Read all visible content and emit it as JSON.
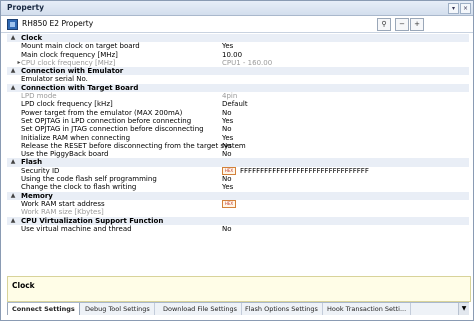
{
  "window": {
    "title": "Property"
  },
  "toolbar": {
    "device_name": "RH850 E2 Property"
  },
  "grid": {
    "categories": [
      {
        "label": "Clock",
        "rows": [
          {
            "name": "Mount main clock on target board",
            "value": "Yes"
          },
          {
            "name": "Main clock frequency [MHz]",
            "value": "10.00"
          },
          {
            "name": "CPU clock frequency [MHz]",
            "value": "CPU1 - 160.00"
          }
        ]
      },
      {
        "label": "Connection with Emulator",
        "rows": [
          {
            "name": "Emulator serial No.",
            "value": ""
          }
        ]
      },
      {
        "label": "Connection with Target Board",
        "rows": [
          {
            "name": "LPD mode",
            "value": "4pin"
          },
          {
            "name": "LPD clock frequency [kHz]",
            "value": "Default"
          },
          {
            "name": "Power target from the emulator (MAX 200mA)",
            "value": "No"
          },
          {
            "name": "Set OPJTAG in LPD connection before connecting",
            "value": "Yes"
          },
          {
            "name": "Set OPJTAG in JTAG connection before disconnecting",
            "value": "No"
          },
          {
            "name": "Initialize RAM when connecting",
            "value": "Yes"
          },
          {
            "name": "Release the RESET before disconnecting from the target system",
            "value": "No"
          },
          {
            "name": "Use the PiggyBack board",
            "value": "No"
          }
        ]
      },
      {
        "label": "Flash",
        "rows": [
          {
            "name": "Security ID",
            "value": "FFFFFFFFFFFFFFFFFFFFFFFFFFFFFFFF",
            "badge": "HEX"
          },
          {
            "name": "Using the code flash self programming",
            "value": "No"
          },
          {
            "name": "Change the clock to flash writing",
            "value": "Yes"
          }
        ]
      },
      {
        "label": "Memory",
        "rows": [
          {
            "name": "Work RAM start address",
            "value": "",
            "badge": "HEX"
          },
          {
            "name": "Work RAM size [Kbytes]",
            "value": ""
          }
        ]
      },
      {
        "label": "CPU Virtualization Support Function",
        "rows": [
          {
            "name": "Use virtual machine and thread",
            "value": "No"
          }
        ]
      }
    ]
  },
  "description": {
    "title": "Clock"
  },
  "tabs": [
    "Connect Settings",
    "Debug Tool Settings",
    "Download File Settings",
    "Flash Options Settings",
    "Hook Transaction Setti..."
  ],
  "icons": {
    "collapse": "minus-box-icon",
    "expand": "plus-box-icon",
    "search": "search-icon"
  }
}
